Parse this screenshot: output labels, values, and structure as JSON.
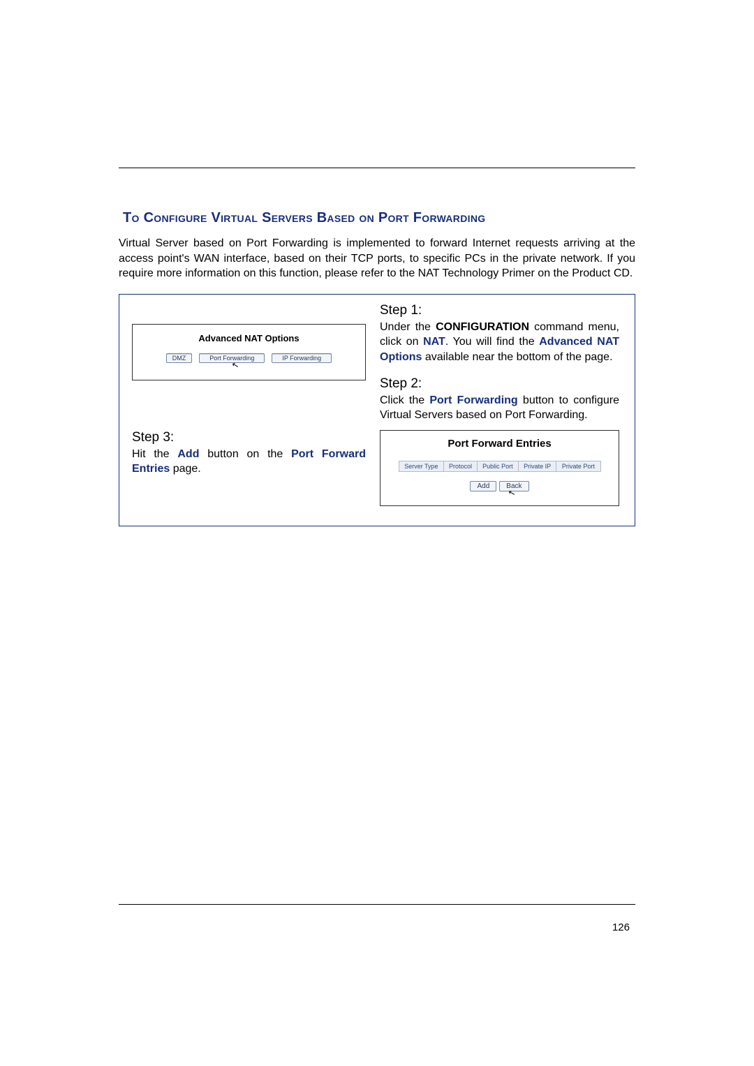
{
  "heading": "To Configure Virtual Servers Based on Port Forwarding",
  "intro": "Virtual Server based on Port Forwarding is implemented to forward Internet requests arriving at the access point's WAN interface, based on their TCP ports, to specific PCs in the private network. If you require more information on this function, please refer to the NAT Technology Primer on the Product CD.",
  "advanced_nat": {
    "title": "Advanced NAT Options",
    "buttons": [
      "DMZ",
      "Port Forwarding",
      "IP Forwarding"
    ]
  },
  "steps": {
    "s1": {
      "head": "Step 1:",
      "pre": "Under the ",
      "k1": "CONFIGURATION",
      "mid1": " command menu, click on ",
      "k2": "NAT",
      "mid2": ". You will find the ",
      "k3": "Advanced NAT Options",
      "post": " available near the bottom of the page."
    },
    "s2": {
      "head": "Step 2:",
      "pre": "Click the ",
      "k1": "Port Forwarding",
      "post": " button to configure Virtual Servers based on Port Forwarding."
    },
    "s3": {
      "head": "Step 3:",
      "pre": "Hit the ",
      "k1": "Add",
      "mid": " button on the ",
      "k2": "Port Forward Entries",
      "post": " page."
    }
  },
  "pfe": {
    "title": "Port Forward Entries",
    "columns": [
      "Server Type",
      "Protocol",
      "Public Port",
      "Private IP",
      "Private Port"
    ],
    "buttons": [
      "Add",
      "Back"
    ]
  },
  "page_number": "126"
}
